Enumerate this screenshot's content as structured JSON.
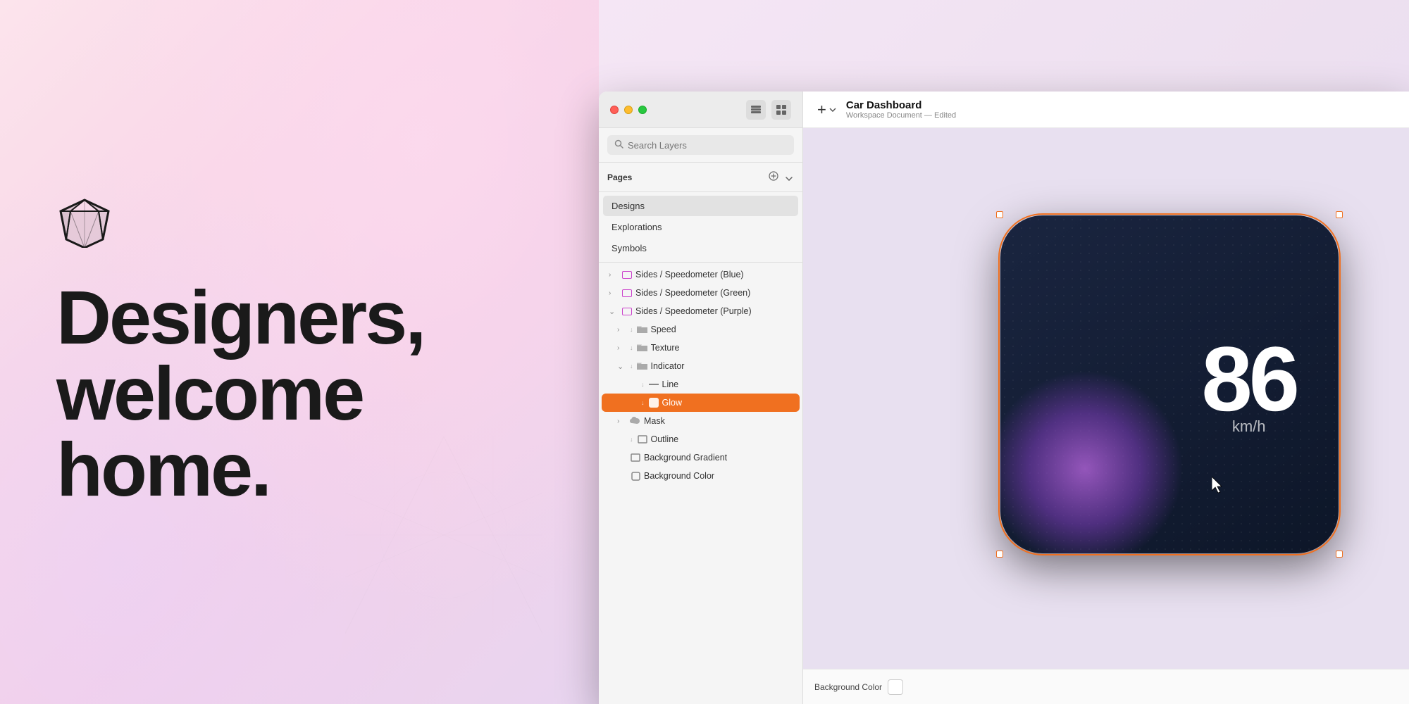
{
  "hero": {
    "title_line1": "Designers,",
    "title_line2": "welcome",
    "title_line3": "home.",
    "bg_color_start": "#fce4ec",
    "bg_color_end": "#e8d5f0"
  },
  "window": {
    "title": "Car Dashboard",
    "subtitle": "Workspace Document — Edited"
  },
  "titlebar": {
    "add_label": "+",
    "icon1": "□",
    "icon2": "⊞"
  },
  "search": {
    "placeholder": "Search Layers"
  },
  "pages": {
    "label": "Pages",
    "add_icon": "⊕",
    "expand_icon": "⌄",
    "items": [
      {
        "name": "Designs",
        "active": true
      },
      {
        "name": "Explorations",
        "active": false
      },
      {
        "name": "Symbols",
        "active": false
      }
    ]
  },
  "layers": [
    {
      "id": "layer1",
      "indent": 0,
      "arrow": "›",
      "has_symbol": false,
      "icon": "artboard",
      "name": "Sides / Speedometer (Blue)",
      "expanded": false
    },
    {
      "id": "layer2",
      "indent": 0,
      "arrow": "›",
      "has_symbol": false,
      "icon": "artboard",
      "name": "Sides / Speedometer (Green)",
      "expanded": false
    },
    {
      "id": "layer3",
      "indent": 0,
      "arrow": "⌄",
      "has_symbol": false,
      "icon": "artboard",
      "name": "Sides / Speedometer (Purple)",
      "expanded": true
    },
    {
      "id": "layer4",
      "indent": 1,
      "arrow": "›",
      "has_symbol": true,
      "icon": "folder",
      "name": "Speed",
      "expanded": false
    },
    {
      "id": "layer5",
      "indent": 1,
      "arrow": "›",
      "has_symbol": true,
      "icon": "folder",
      "name": "Texture",
      "expanded": false
    },
    {
      "id": "layer6",
      "indent": 1,
      "arrow": "⌄",
      "has_symbol": true,
      "icon": "folder",
      "name": "Indicator",
      "expanded": true
    },
    {
      "id": "layer7",
      "indent": 2,
      "arrow": "",
      "has_symbol": true,
      "icon": "line",
      "name": "Line",
      "expanded": false
    },
    {
      "id": "layer8",
      "indent": 2,
      "arrow": "",
      "has_symbol": true,
      "icon": "glow",
      "name": "Glow",
      "expanded": false,
      "selected": true
    },
    {
      "id": "layer9",
      "indent": 1,
      "arrow": "›",
      "has_symbol": false,
      "icon": "cloud",
      "name": "Mask",
      "expanded": false
    },
    {
      "id": "layer10",
      "indent": 1,
      "arrow": "",
      "has_symbol": true,
      "icon": "rect",
      "name": "Outline",
      "expanded": false
    },
    {
      "id": "layer11",
      "indent": 1,
      "arrow": "",
      "has_symbol": false,
      "icon": "rect",
      "name": "Background Gradient",
      "expanded": false
    },
    {
      "id": "layer12",
      "indent": 1,
      "arrow": "",
      "has_symbol": false,
      "icon": "checkbox",
      "name": "Background Color",
      "expanded": false
    }
  ],
  "speedometer": {
    "value": "86",
    "unit": "km/h"
  },
  "bottom_bar": {
    "label": "Background Color"
  },
  "colors": {
    "accent_orange": "#f07020",
    "artboard_border": "#cc44cc"
  }
}
